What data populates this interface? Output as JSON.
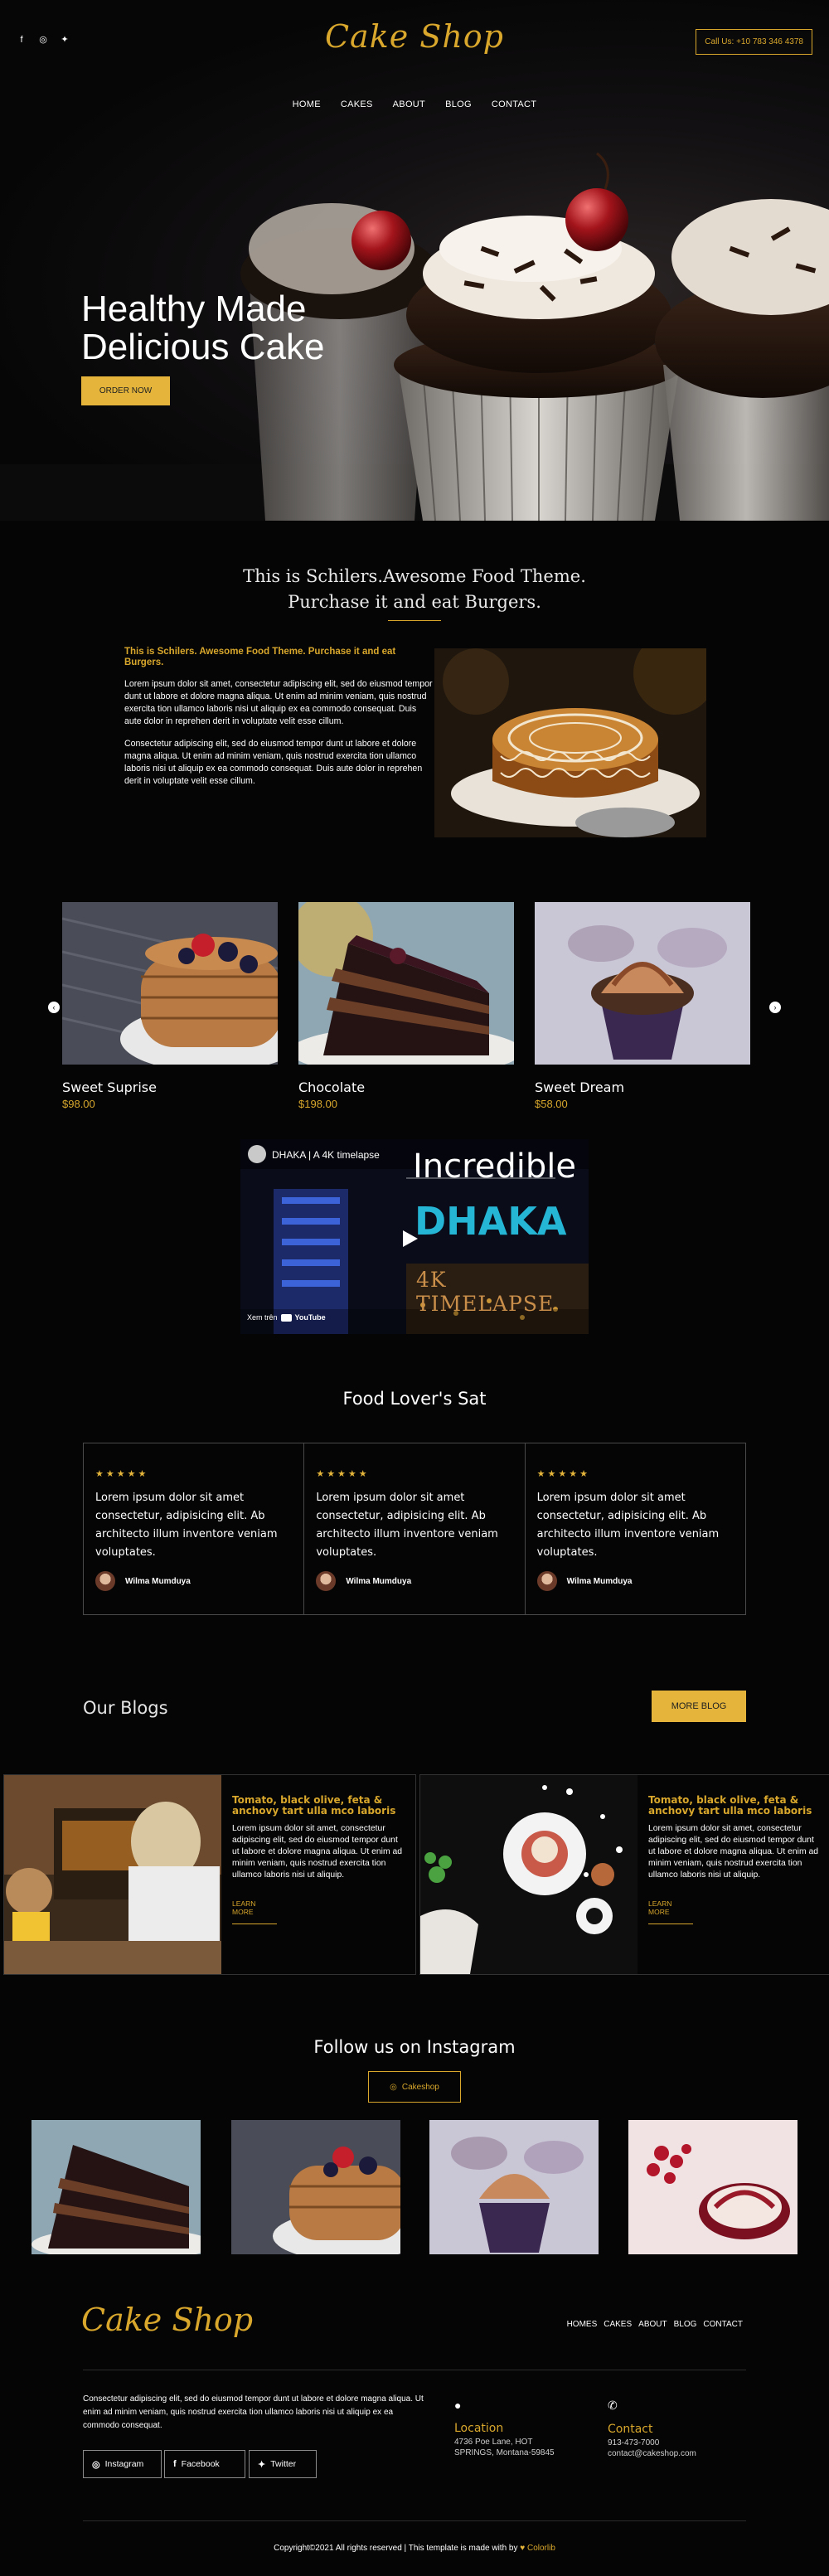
{
  "header": {
    "logo": "Cake Shop",
    "social_icons": [
      "facebook-icon",
      "instagram-icon",
      "twitter-icon"
    ],
    "call_button": "Call Us: +10 783 346 4378"
  },
  "nav": [
    "HOME",
    "CAKES",
    "ABOUT",
    "BLOG",
    "CONTACT"
  ],
  "hero": {
    "title_line1": "Healthy Made",
    "title_line2": "Delicious Cake",
    "button": "ORDER NOW"
  },
  "about": {
    "heading_line1": "This is Schilers.Awesome Food Theme.",
    "heading_line2": "Purchase it and eat Burgers.",
    "subheading": "This is Schilers. Awesome Food Theme. Purchase it and eat Burgers.",
    "paragraph1": "Lorem ipsum dolor sit amet, consectetur adipiscing elit, sed do eiusmod tempor dunt ut labore et dolore magna aliqua. Ut enim ad minim veniam, quis nostrud exercita tion ullamco laboris nisi ut aliquip ex ea commodo consequat. Duis aute dolor in reprehen derit in voluptate velit esse cillum.",
    "paragraph2": "Consectetur adipiscing elit, sed do eiusmod tempor dunt ut labore et dolore magna aliqua. Ut enim ad minim veniam, quis nostrud exercita tion ullamco laboris nisi ut aliquip ex ea commodo consequat. Duis aute dolor in reprehen derit in voluptate velit esse cillum."
  },
  "products": [
    {
      "name": "Sweet Suprise",
      "price": "$98.00"
    },
    {
      "name": "Chocolate",
      "price": "$198.00"
    },
    {
      "name": "Sweet Dream",
      "price": "$58.00"
    }
  ],
  "video": {
    "channel_title": "DHAKA | A 4K timelapse",
    "overlay_line1": "Incredible",
    "overlay_line2": "DHAKA",
    "overlay_line3": "4K TIMELAPSE",
    "watch_on": "Xem trên",
    "youtube": "YouTube"
  },
  "testimonials": {
    "title": "Food Lover's Sat",
    "stars": "★★★★★",
    "items": [
      {
        "text": "Lorem ipsum dolor sit amet consectetur, adipisicing elit. Ab architecto illum inventore veniam voluptates.",
        "author": "Wilma Mumduya"
      },
      {
        "text": "Lorem ipsum dolor sit amet consectetur, adipisicing elit. Ab architecto illum inventore veniam voluptates.",
        "author": "Wilma Mumduya"
      },
      {
        "text": "Lorem ipsum dolor sit amet consectetur, adipisicing elit. Ab architecto illum inventore veniam voluptates.",
        "author": "Wilma Mumduya"
      }
    ]
  },
  "blogs": {
    "title": "Our Blogs",
    "more_button": "MORE BLOG",
    "items": [
      {
        "title": "Tomato, black olive, feta & anchovy tart ulla mco laboris",
        "text": "Lorem ipsum dolor sit amet, consectetur adipiscing elit, sed do eiusmod tempor dunt ut labore et dolore magna aliqua. Ut enim ad minim veniam, quis nostrud exercita tion ullamco laboris nisi ut aliquip.",
        "link": "LEARN MORE"
      },
      {
        "title": "Tomato, black olive, feta & anchovy tart ulla mco laboris",
        "text": "Lorem ipsum dolor sit amet, consectetur adipiscing elit, sed do eiusmod tempor dunt ut labore et dolore magna aliqua. Ut enim ad minim veniam, quis nostrud exercita tion ullamco laboris nisi ut aliquip.",
        "link": "LEARN MORE"
      }
    ]
  },
  "instagram": {
    "title": "Follow us on Instagram",
    "button": "Cakeshop"
  },
  "footer": {
    "logo": "Cake Shop",
    "nav": [
      "HOMES",
      "CAKES",
      "ABOUT",
      "BLOG",
      "CONTACT"
    ],
    "about": "Consectetur adipiscing elit, sed do eiusmod tempor dunt ut labore et dolore magna aliqua. Ut enim ad minim veniam, quis nostrud exercita tion ullamco laboris nisi ut aliquip ex ea commodo consequat.",
    "socials": [
      "Instagram",
      "Facebook",
      "Twitter"
    ],
    "location_title": "Location",
    "location_line1": "4736 Poe Lane, HOT",
    "location_line2": "SPRINGS, Montana-59845",
    "contact_title": "Contact",
    "contact_phone": "913-473-7000",
    "contact_email": "contact@cakeshop.com",
    "copyright": "Copyright©2021 All rights reserved | This template is made with by",
    "brand": "Colorlib"
  },
  "colors": {
    "accent": "#d8a72c",
    "button": "#e4b53a",
    "background": "#050505"
  }
}
